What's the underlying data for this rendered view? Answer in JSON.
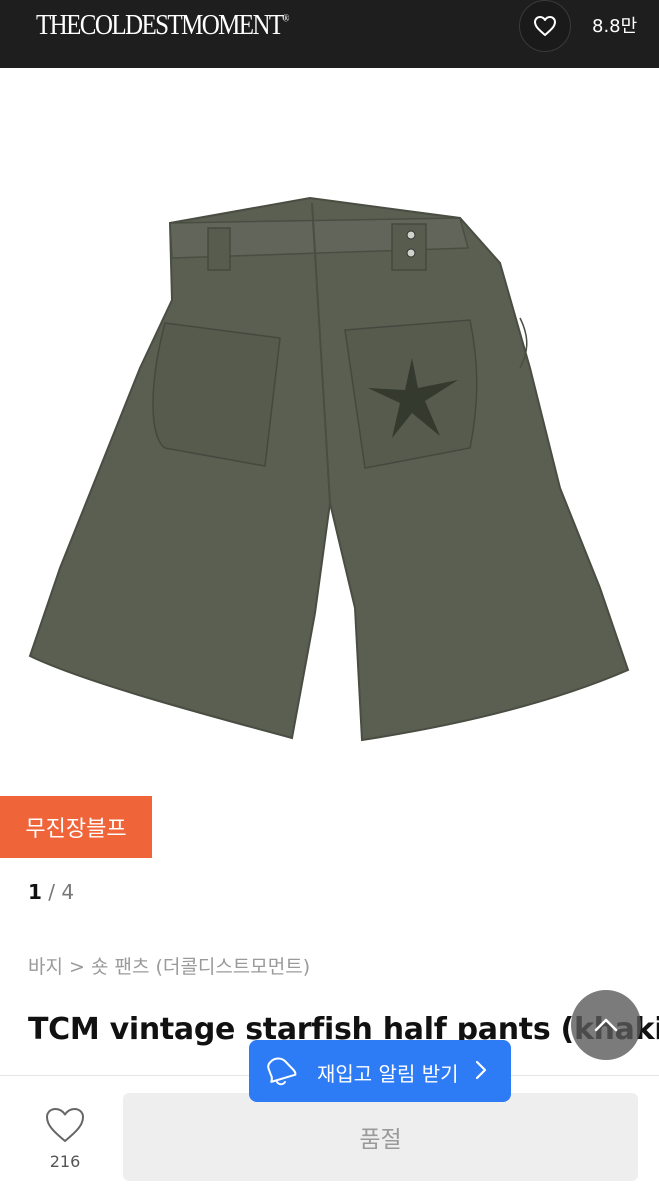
{
  "header": {
    "brand": "THECOLDESTMOMENT",
    "brand_mark": "®",
    "favorite_count": "8.8만"
  },
  "gallery": {
    "current": "1",
    "separator": "/",
    "total": "4"
  },
  "seller": {
    "badge": "무진장블프",
    "badge_color": "#f0643a"
  },
  "product": {
    "breadcrumb": "바지 > 숏 팬츠 (더콜디스트모먼트)",
    "title": "TCM vintage starfish half pants (khaki)",
    "image_color": "#5b5f52"
  },
  "actions": {
    "restock_label": "재입고 알림 받기",
    "restock_color": "#2e7bf6",
    "soldout_label": "품절",
    "like_count": "216"
  }
}
